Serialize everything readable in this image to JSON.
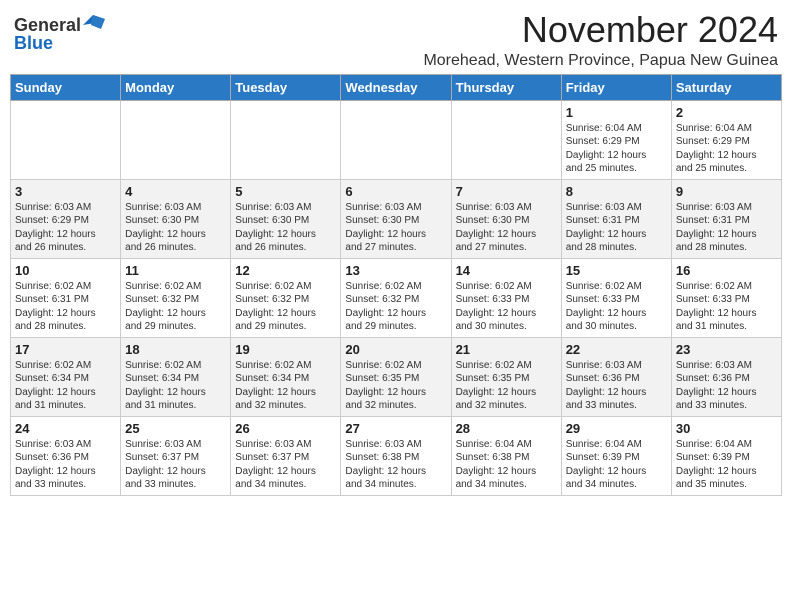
{
  "header": {
    "logo_general": "General",
    "logo_blue": "Blue",
    "month": "November 2024",
    "location": "Morehead, Western Province, Papua New Guinea"
  },
  "days_of_week": [
    "Sunday",
    "Monday",
    "Tuesday",
    "Wednesday",
    "Thursday",
    "Friday",
    "Saturday"
  ],
  "weeks": [
    [
      {
        "day": "",
        "info": ""
      },
      {
        "day": "",
        "info": ""
      },
      {
        "day": "",
        "info": ""
      },
      {
        "day": "",
        "info": ""
      },
      {
        "day": "",
        "info": ""
      },
      {
        "day": "1",
        "info": "Sunrise: 6:04 AM\nSunset: 6:29 PM\nDaylight: 12 hours\nand 25 minutes."
      },
      {
        "day": "2",
        "info": "Sunrise: 6:04 AM\nSunset: 6:29 PM\nDaylight: 12 hours\nand 25 minutes."
      }
    ],
    [
      {
        "day": "3",
        "info": "Sunrise: 6:03 AM\nSunset: 6:29 PM\nDaylight: 12 hours\nand 26 minutes."
      },
      {
        "day": "4",
        "info": "Sunrise: 6:03 AM\nSunset: 6:30 PM\nDaylight: 12 hours\nand 26 minutes."
      },
      {
        "day": "5",
        "info": "Sunrise: 6:03 AM\nSunset: 6:30 PM\nDaylight: 12 hours\nand 26 minutes."
      },
      {
        "day": "6",
        "info": "Sunrise: 6:03 AM\nSunset: 6:30 PM\nDaylight: 12 hours\nand 27 minutes."
      },
      {
        "day": "7",
        "info": "Sunrise: 6:03 AM\nSunset: 6:30 PM\nDaylight: 12 hours\nand 27 minutes."
      },
      {
        "day": "8",
        "info": "Sunrise: 6:03 AM\nSunset: 6:31 PM\nDaylight: 12 hours\nand 28 minutes."
      },
      {
        "day": "9",
        "info": "Sunrise: 6:03 AM\nSunset: 6:31 PM\nDaylight: 12 hours\nand 28 minutes."
      }
    ],
    [
      {
        "day": "10",
        "info": "Sunrise: 6:02 AM\nSunset: 6:31 PM\nDaylight: 12 hours\nand 28 minutes."
      },
      {
        "day": "11",
        "info": "Sunrise: 6:02 AM\nSunset: 6:32 PM\nDaylight: 12 hours\nand 29 minutes."
      },
      {
        "day": "12",
        "info": "Sunrise: 6:02 AM\nSunset: 6:32 PM\nDaylight: 12 hours\nand 29 minutes."
      },
      {
        "day": "13",
        "info": "Sunrise: 6:02 AM\nSunset: 6:32 PM\nDaylight: 12 hours\nand 29 minutes."
      },
      {
        "day": "14",
        "info": "Sunrise: 6:02 AM\nSunset: 6:33 PM\nDaylight: 12 hours\nand 30 minutes."
      },
      {
        "day": "15",
        "info": "Sunrise: 6:02 AM\nSunset: 6:33 PM\nDaylight: 12 hours\nand 30 minutes."
      },
      {
        "day": "16",
        "info": "Sunrise: 6:02 AM\nSunset: 6:33 PM\nDaylight: 12 hours\nand 31 minutes."
      }
    ],
    [
      {
        "day": "17",
        "info": "Sunrise: 6:02 AM\nSunset: 6:34 PM\nDaylight: 12 hours\nand 31 minutes."
      },
      {
        "day": "18",
        "info": "Sunrise: 6:02 AM\nSunset: 6:34 PM\nDaylight: 12 hours\nand 31 minutes."
      },
      {
        "day": "19",
        "info": "Sunrise: 6:02 AM\nSunset: 6:34 PM\nDaylight: 12 hours\nand 32 minutes."
      },
      {
        "day": "20",
        "info": "Sunrise: 6:02 AM\nSunset: 6:35 PM\nDaylight: 12 hours\nand 32 minutes."
      },
      {
        "day": "21",
        "info": "Sunrise: 6:02 AM\nSunset: 6:35 PM\nDaylight: 12 hours\nand 32 minutes."
      },
      {
        "day": "22",
        "info": "Sunrise: 6:03 AM\nSunset: 6:36 PM\nDaylight: 12 hours\nand 33 minutes."
      },
      {
        "day": "23",
        "info": "Sunrise: 6:03 AM\nSunset: 6:36 PM\nDaylight: 12 hours\nand 33 minutes."
      }
    ],
    [
      {
        "day": "24",
        "info": "Sunrise: 6:03 AM\nSunset: 6:36 PM\nDaylight: 12 hours\nand 33 minutes."
      },
      {
        "day": "25",
        "info": "Sunrise: 6:03 AM\nSunset: 6:37 PM\nDaylight: 12 hours\nand 33 minutes."
      },
      {
        "day": "26",
        "info": "Sunrise: 6:03 AM\nSunset: 6:37 PM\nDaylight: 12 hours\nand 34 minutes."
      },
      {
        "day": "27",
        "info": "Sunrise: 6:03 AM\nSunset: 6:38 PM\nDaylight: 12 hours\nand 34 minutes."
      },
      {
        "day": "28",
        "info": "Sunrise: 6:04 AM\nSunset: 6:38 PM\nDaylight: 12 hours\nand 34 minutes."
      },
      {
        "day": "29",
        "info": "Sunrise: 6:04 AM\nSunset: 6:39 PM\nDaylight: 12 hours\nand 34 minutes."
      },
      {
        "day": "30",
        "info": "Sunrise: 6:04 AM\nSunset: 6:39 PM\nDaylight: 12 hours\nand 35 minutes."
      }
    ]
  ]
}
